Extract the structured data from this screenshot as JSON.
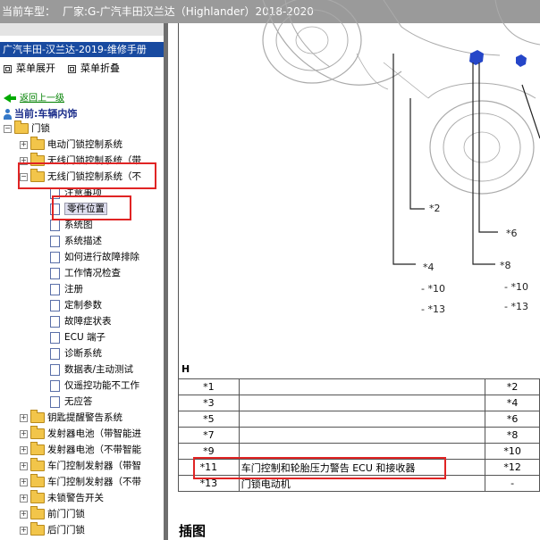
{
  "window": {
    "car_model_label": "当前车型：",
    "car_model_value": "厂家:G-广汽丰田汉兰达（Highlander）2018-2020"
  },
  "sidebar": {
    "manual_title": "广汽丰田-汉兰达-2019-维修手册",
    "expand_all": "菜单展开",
    "collapse_all": "菜单折叠",
    "back_link": "返回上一级",
    "current_path": "当前:车辆内饰",
    "root": "门锁",
    "folders_top": [
      "电动门锁控制系统",
      "无线门锁控制系统（带",
      "无线门锁控制系统（不"
    ],
    "docs": [
      "注意事项",
      "零件位置",
      "系统图",
      "系统描述",
      "如何进行故障排除",
      "工作情况检查",
      "注册",
      "定制参数",
      "故障症状表",
      "ECU 端子",
      "诊断系统",
      "数据表/主动测试",
      "仅遥控功能不工作",
      "无应答"
    ],
    "folders_bottom": [
      "钥匙提醒警告系统",
      "发射器电池（带智能进",
      "发射器电池（不带智能",
      "车门控制发射器（带智",
      "车门控制发射器（不带",
      "未锁警告开关",
      "前门门锁",
      "后门门锁"
    ]
  },
  "diagram": {
    "callouts": [
      "*2",
      "*6",
      "*4",
      "*8",
      "- *10",
      "- *13",
      "- *10",
      "- *13"
    ]
  },
  "legend_table": {
    "header": "H",
    "rows": [
      [
        "*1",
        "",
        "*2"
      ],
      [
        "*3",
        "",
        "*4"
      ],
      [
        "*5",
        "",
        "*6"
      ],
      [
        "*7",
        "",
        "*8"
      ],
      [
        "*9",
        "",
        "*10"
      ],
      [
        "*11",
        "车门控制和轮胎压力警告 ECU 和接收器",
        "*12"
      ],
      [
        "*13",
        "门锁电动机",
        "-"
      ]
    ]
  },
  "content": {
    "next_heading": "插图"
  },
  "colors": {
    "title_bar": "#184aa0",
    "highlight": "#e02424",
    "top_bar": "#9a9a9a"
  }
}
